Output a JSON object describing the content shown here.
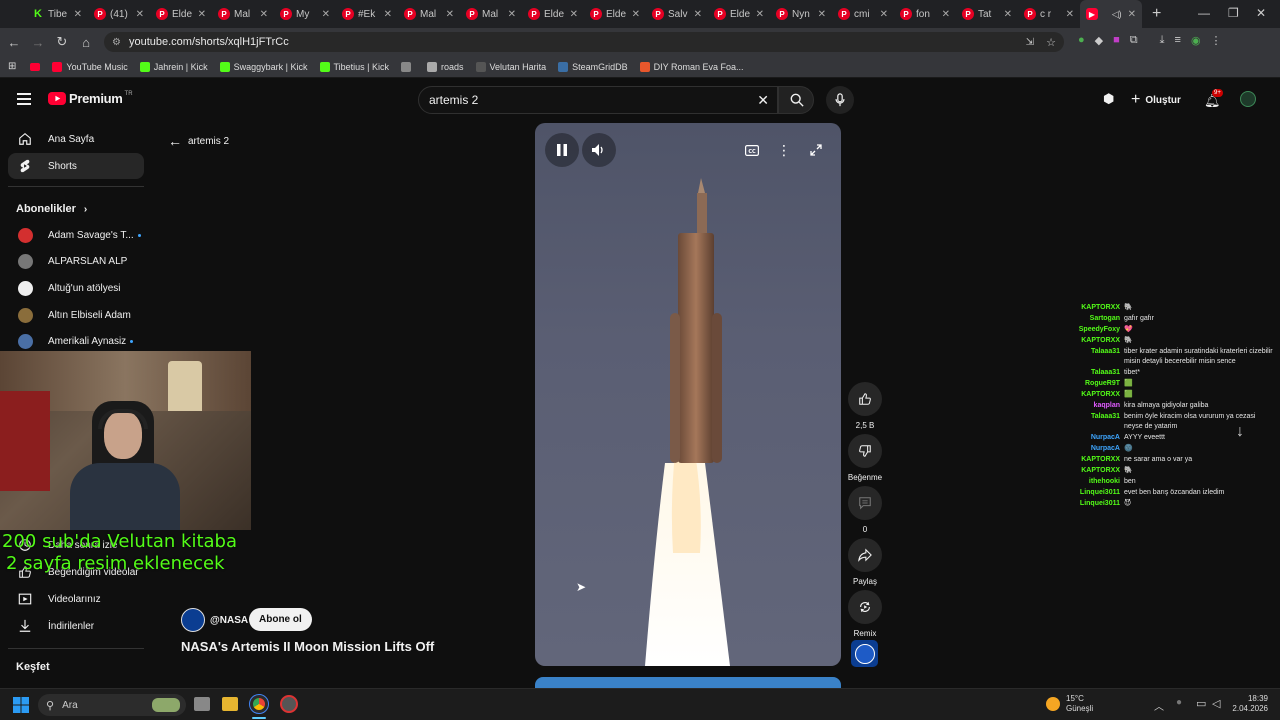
{
  "browser": {
    "tabs": [
      {
        "label": "Tibe",
        "icon": "kick"
      },
      {
        "label": "(41)",
        "icon": "pinterest"
      },
      {
        "label": "Elde",
        "icon": "pinterest"
      },
      {
        "label": "Mal",
        "icon": "pinterest"
      },
      {
        "label": "My",
        "icon": "pinterest"
      },
      {
        "label": "#Ek",
        "icon": "pinterest"
      },
      {
        "label": "Mal",
        "icon": "pinterest"
      },
      {
        "label": "Mal",
        "icon": "pinterest"
      },
      {
        "label": "Elde",
        "icon": "pinterest"
      },
      {
        "label": "Elde",
        "icon": "pinterest"
      },
      {
        "label": "Salv",
        "icon": "pinterest"
      },
      {
        "label": "Elde",
        "icon": "pinterest"
      },
      {
        "label": "Nyn",
        "icon": "pinterest"
      },
      {
        "label": "cmi",
        "icon": "pinterest"
      },
      {
        "label": "fon",
        "icon": "pinterest"
      },
      {
        "label": "Tat",
        "icon": "pinterest"
      },
      {
        "label": "c r",
        "icon": "pinterest"
      },
      {
        "label": "",
        "icon": "youtube"
      }
    ],
    "url": "youtube.com/shorts/xqlH1jFTrCc",
    "bookmarks": [
      {
        "label": "YouTube Music",
        "color": "#ff0033"
      },
      {
        "label": "Jahrein | Kick",
        "color": "#53fc18"
      },
      {
        "label": "Swaggybark | Kick",
        "color": "#53fc18"
      },
      {
        "label": "Tibetius | Kick",
        "color": "#53fc18"
      },
      {
        "label": "",
        "color": "#888888"
      },
      {
        "label": "roads",
        "color": "#aaaaaa"
      },
      {
        "label": "Velutan Harita",
        "color": "#555555"
      },
      {
        "label": "SteamGridDB",
        "color": "#3a6ea5"
      },
      {
        "label": "DIY Roman Eva Foa...",
        "color": "#e8572c"
      }
    ]
  },
  "youtube": {
    "logo": "Premium",
    "logo_sup": "TR",
    "search_value": "artemis 2",
    "create_label": "Oluştur",
    "notif_count": "9+",
    "back_label": "artemis 2",
    "sidebar": {
      "nav": [
        {
          "label": "Ana Sayfa"
        },
        {
          "label": "Shorts"
        }
      ],
      "subs_title": "Abonelikler",
      "subs": [
        {
          "label": "Adam Savage's T...",
          "color": "#d32f2f",
          "dot": true
        },
        {
          "label": "ALPARSLAN ALP",
          "color": "#777777",
          "dot": false
        },
        {
          "label": "Altuğ'un atölyesi",
          "color": "#eeeeee",
          "dot": false
        },
        {
          "label": "Altın Elbiseli Adam",
          "color": "#8a6d3b",
          "dot": false
        },
        {
          "label": "Amerikali Aynasiz",
          "color": "#4a6fa5",
          "dot": true
        }
      ],
      "you_items": [
        {
          "label": "Daha sonra izle"
        },
        {
          "label": "Beğendiğim videolar"
        },
        {
          "label": "Videolarınız"
        },
        {
          "label": "İndirilenler"
        }
      ],
      "explore_title": "Keşfet"
    },
    "short": {
      "channel": "@NASA",
      "subscribe": "Abone ol",
      "title": "NASA's Artemis II Moon Mission Lifts Off",
      "likes": "2,5 B",
      "dislike_label": "Beğenme",
      "comments": "0",
      "share_label": "Paylaş",
      "remix_label": "Remix"
    }
  },
  "overlay": {
    "line1": "200 sub'da Velutan kitaba",
    "line2": "2 sayfa resim eklenecek"
  },
  "chat": [
    {
      "user": "KAPTORXX",
      "color": "#53fc18",
      "msg": "🐘"
    },
    {
      "user": "Sartogan",
      "color": "#53fc18",
      "msg": "gafır gafır"
    },
    {
      "user": "SpeedyFoxy",
      "color": "#53fc18",
      "msg": "💖"
    },
    {
      "user": "KAPTORXX",
      "color": "#53fc18",
      "msg": "🐘"
    },
    {
      "user": "Talaaa31",
      "color": "#53fc18",
      "msg": "tiber krater adamin suratindaki kraterleri cizebilir misin detayli becerebilir misin sence"
    },
    {
      "user": "Talaaa31",
      "color": "#53fc18",
      "msg": "tibet*"
    },
    {
      "user": "RogueR9T",
      "color": "#53fc18",
      "msg": "🟩"
    },
    {
      "user": "KAPTORXX",
      "color": "#53fc18",
      "msg": "🟩"
    },
    {
      "user": "kaqplan",
      "color": "#e05cff",
      "msg": "kira almaya gidiyolar galiba"
    },
    {
      "user": "Talaaa31",
      "color": "#53fc18",
      "msg": "benim öyle kiracim olsa vururum ya cezasi neyse de yatarim"
    },
    {
      "user": "NurpacA",
      "color": "#3ea6ff",
      "msg": "AYYY eveettt"
    },
    {
      "user": "NurpacA",
      "color": "#3ea6ff",
      "msg": "🌚"
    },
    {
      "user": "KAPTORXX",
      "color": "#53fc18",
      "msg": "ne sarar ama o var ya"
    },
    {
      "user": "KAPTORXX",
      "color": "#53fc18",
      "msg": "🐘"
    },
    {
      "user": "ithehooki",
      "color": "#53fc18",
      "msg": "ben"
    },
    {
      "user": "Linquei3011",
      "color": "#53fc18",
      "msg": "evet ben barış özcandan izledim"
    },
    {
      "user": "Linquei3011",
      "color": "#53fc18",
      "msg": "😈"
    }
  ],
  "taskbar": {
    "search_label": "Ara",
    "weather_temp": "15°C",
    "weather_desc": "Güneşli",
    "time": "18:39",
    "date": "2.04.2026"
  }
}
